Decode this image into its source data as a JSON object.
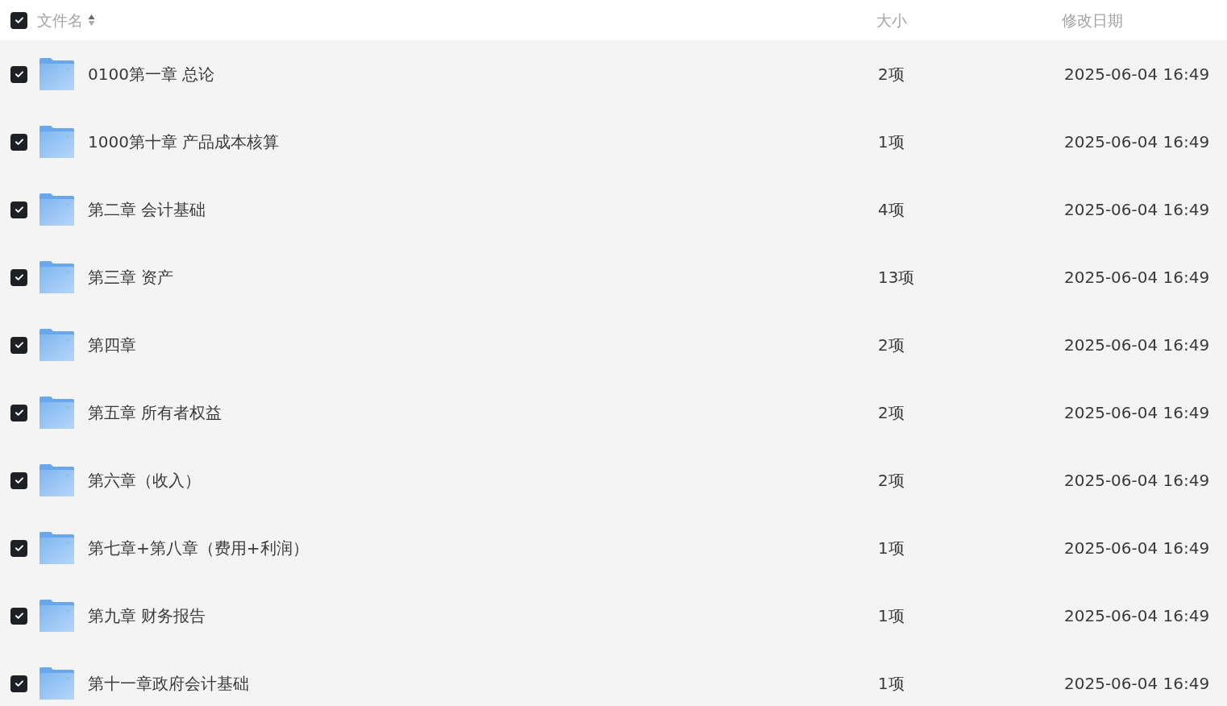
{
  "header": {
    "checked": true,
    "columns": [
      {
        "label": "文件名",
        "sortable": true
      },
      {
        "label": "大小"
      },
      {
        "label": "修改日期"
      }
    ]
  },
  "rows": [
    {
      "name": "0100第一章 总论",
      "size": "2项",
      "modified": "2025-06-04 16:49",
      "checked": true
    },
    {
      "name": "1000第十章 产品成本核算",
      "size": "1项",
      "modified": "2025-06-04 16:49",
      "checked": true
    },
    {
      "name": "第二章 会计基础",
      "size": "4项",
      "modified": "2025-06-04 16:49",
      "checked": true
    },
    {
      "name": "第三章 资产",
      "size": "13项",
      "modified": "2025-06-04 16:49",
      "checked": true
    },
    {
      "name": "第四章",
      "size": "2项",
      "modified": "2025-06-04 16:49",
      "checked": true
    },
    {
      "name": "第五章 所有者权益",
      "size": "2项",
      "modified": "2025-06-04 16:49",
      "checked": true
    },
    {
      "name": "第六章（收入）",
      "size": "2项",
      "modified": "2025-06-04 16:49",
      "checked": true
    },
    {
      "name": "第七章+第八章（费用+利润）",
      "size": "1项",
      "modified": "2025-06-04 16:49",
      "checked": true
    },
    {
      "name": "第九章 财务报告",
      "size": "1项",
      "modified": "2025-06-04 16:49",
      "checked": true
    },
    {
      "name": "第十一章政府会计基础",
      "size": "1项",
      "modified": "2025-06-04 16:49",
      "checked": true
    }
  ]
}
